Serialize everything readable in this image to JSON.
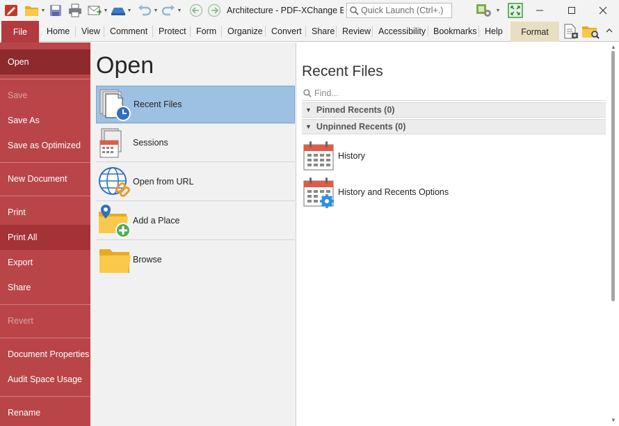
{
  "window": {
    "title": "Architecture - PDF-XChange E...",
    "quick_launch_placeholder": "Quick Launch (Ctrl+.)"
  },
  "ribbon": {
    "file_tab": "File",
    "tabs": [
      "Home",
      "View",
      "Comment",
      "Protect",
      "Form",
      "Organize",
      "Convert",
      "Share",
      "Review",
      "Accessibility",
      "Bookmarks",
      "Help"
    ],
    "context_tab": "Format"
  },
  "menu": {
    "items": [
      {
        "label": "Open",
        "state": "active"
      },
      {
        "label": "Save",
        "state": "disabled"
      },
      {
        "label": "Save As",
        "state": "normal"
      },
      {
        "label": "Save as Optimized",
        "state": "normal"
      },
      {
        "label": "New Document",
        "state": "normal"
      },
      {
        "label": "Print",
        "state": "normal"
      },
      {
        "label": "Print All",
        "state": "hover"
      },
      {
        "label": "Export",
        "state": "normal"
      },
      {
        "label": "Share",
        "state": "normal"
      },
      {
        "label": "Revert",
        "state": "disabled"
      },
      {
        "label": "Document Properties",
        "state": "normal"
      },
      {
        "label": "Audit Space Usage",
        "state": "normal"
      },
      {
        "label": "Rename",
        "state": "normal"
      }
    ]
  },
  "open_panel": {
    "title": "Open",
    "options": [
      {
        "label": "Recent Files",
        "icon": "recent-files-icon",
        "selected": true
      },
      {
        "label": "Sessions",
        "icon": "sessions-icon",
        "selected": false
      },
      {
        "label": "Open from URL",
        "icon": "globe-link-icon",
        "selected": false
      },
      {
        "label": "Add a Place",
        "icon": "add-place-icon",
        "selected": false
      },
      {
        "label": "Browse",
        "icon": "folder-icon",
        "selected": false
      }
    ]
  },
  "recent_panel": {
    "title": "Recent Files",
    "find_placeholder": "Find...",
    "groups": [
      "Pinned Recents (0)",
      "Unpinned Recents (0)"
    ],
    "items": [
      {
        "label": "History",
        "icon": "calendar-icon"
      },
      {
        "label": "History and Recents Options",
        "icon": "calendar-gear-icon"
      }
    ]
  },
  "colors": {
    "accent": "#b94548",
    "active_menu": "#8c2a2e",
    "selection": "#9dc1e3"
  }
}
